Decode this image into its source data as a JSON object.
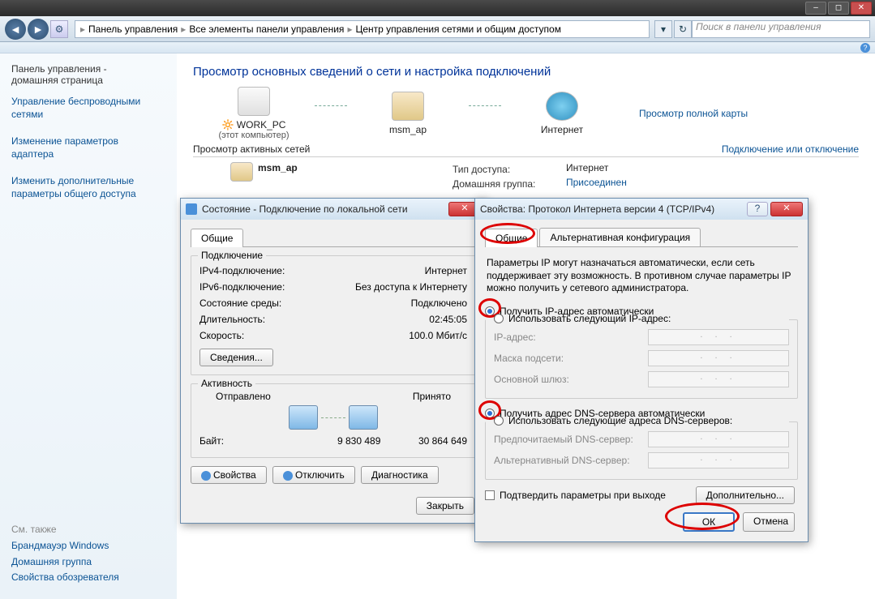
{
  "titlebar": {},
  "addressbar": {
    "crumb1": "Панель управления",
    "crumb2": "Все элементы панели управления",
    "crumb3": "Центр управления сетями и общим доступом",
    "search_placeholder": "Поиск в панели управления"
  },
  "sidebar": {
    "home1": "Панель управления -",
    "home2": "домашняя страница",
    "link1a": "Управление беспроводными",
    "link1b": "сетями",
    "link2a": "Изменение параметров",
    "link2b": "адаптера",
    "link3a": "Изменить дополнительные",
    "link3b": "параметры общего доступа",
    "seealso_hdr": "См. также",
    "see1": "Брандмауэр Windows",
    "see2": "Домашняя группа",
    "see3": "Свойства обозревателя"
  },
  "content": {
    "title": "Просмотр основных сведений о сети и настройка подключений",
    "node1": "WORK_PC",
    "node1_sub": "(этот компьютер)",
    "node2": "msm_ap",
    "node3": "Интернет",
    "fullmap": "Просмотр полной карты",
    "active_nets": "Просмотр активных сетей",
    "connect_link": "Подключение или отключение",
    "access_type_lbl": "Тип доступа:",
    "access_type_val": "Интернет",
    "homegroup_lbl": "Домашняя группа:",
    "homegroup_val": "Присоединен",
    "net_name": "msm_ap"
  },
  "status_dlg": {
    "title": "Состояние - Подключение по локальной сети",
    "tab1": "Общие",
    "grp_connection": "Подключение",
    "ipv4_lbl": "IPv4-подключение:",
    "ipv4_val": "Интернет",
    "ipv6_lbl": "IPv6-подключение:",
    "ipv6_val": "Без доступа к Интернету",
    "media_lbl": "Состояние среды:",
    "media_val": "Подключено",
    "duration_lbl": "Длительность:",
    "duration_val": "02:45:05",
    "speed_lbl": "Скорость:",
    "speed_val": "100.0 Мбит/с",
    "details_btn": "Сведения...",
    "grp_activity": "Активность",
    "sent_lbl": "Отправлено",
    "recv_lbl": "Принято",
    "bytes_lbl": "Байт:",
    "sent_val": "9 830 489",
    "recv_val": "30 864 649",
    "props_btn": "Свойства",
    "disable_btn": "Отключить",
    "diag_btn": "Диагностика",
    "close_btn": "Закрыть"
  },
  "ipv4_dlg": {
    "title": "Свойства: Протокол Интернета версии 4 (TCP/IPv4)",
    "tab1": "Общие",
    "tab2": "Альтернативная конфигурация",
    "intro": "Параметры IP могут назначаться автоматически, если сеть поддерживает эту возможность. В противном случае параметры IP можно получить у сетевого администратора.",
    "r_auto_ip": "Получить IP-адрес автоматически",
    "r_static_ip": "Использовать следующий IP-адрес:",
    "ip_lbl": "IP-адрес:",
    "mask_lbl": "Маска подсети:",
    "gw_lbl": "Основной шлюз:",
    "r_auto_dns": "Получить адрес DNS-сервера автоматически",
    "r_static_dns": "Использовать следующие адреса DNS-серверов:",
    "dns1_lbl": "Предпочитаемый DNS-сервер:",
    "dns2_lbl": "Альтернативный DNS-сервер:",
    "validate": "Подтвердить параметры при выходе",
    "advanced": "Дополнительно...",
    "ok": "ОК",
    "cancel": "Отмена"
  }
}
